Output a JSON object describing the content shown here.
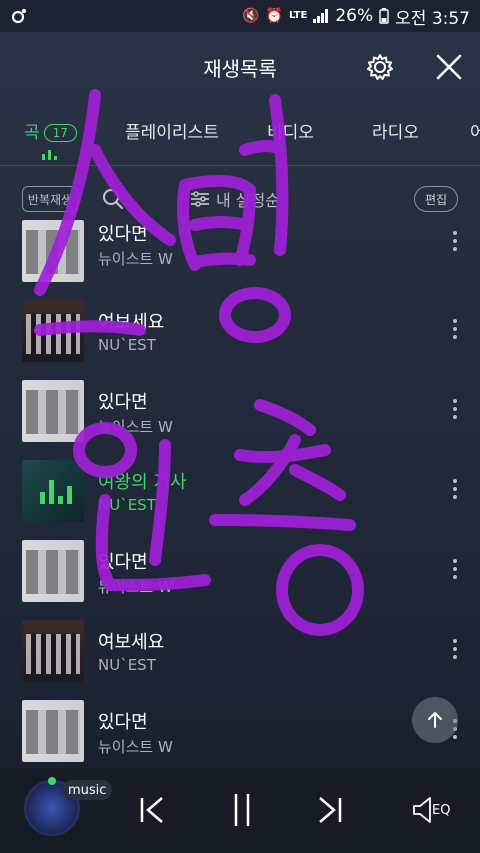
{
  "status_bar": {
    "battery": "26%",
    "time": "오전 3:57",
    "network": "LTE"
  },
  "header": {
    "title": "재생목록"
  },
  "tabs": [
    {
      "label": "곡",
      "count": "17",
      "active": true
    },
    {
      "label": "플레이리스트",
      "active": false
    },
    {
      "label": "비디오",
      "active": false
    },
    {
      "label": "라디오",
      "active": false
    },
    {
      "label": "어",
      "active": false
    }
  ],
  "toolbar": {
    "repeat_label": "반복재생",
    "sort_label": "내 설정순",
    "edit_label": "편집"
  },
  "songs": [
    {
      "title": "있다면",
      "artist": "뉴이스트 W",
      "cover": "light"
    },
    {
      "title": "여보세요",
      "artist": "NU`EST",
      "cover": "dark"
    },
    {
      "title": "있다면",
      "artist": "뉴이스트 W",
      "cover": "light"
    },
    {
      "title": "여왕의 기사",
      "artist": "NU`EST",
      "cover": "teal",
      "playing": true
    },
    {
      "title": "있다면",
      "artist": "뉴이스트 W",
      "cover": "light"
    },
    {
      "title": "여보세요",
      "artist": "NU`EST",
      "cover": "dark"
    },
    {
      "title": "있다면",
      "artist": "뉴이스트 W",
      "cover": "light"
    }
  ],
  "player": {
    "label": "music",
    "eq_label": "EQ"
  },
  "colors": {
    "accent": "#45d36b",
    "scribble": "#a020d8"
  }
}
